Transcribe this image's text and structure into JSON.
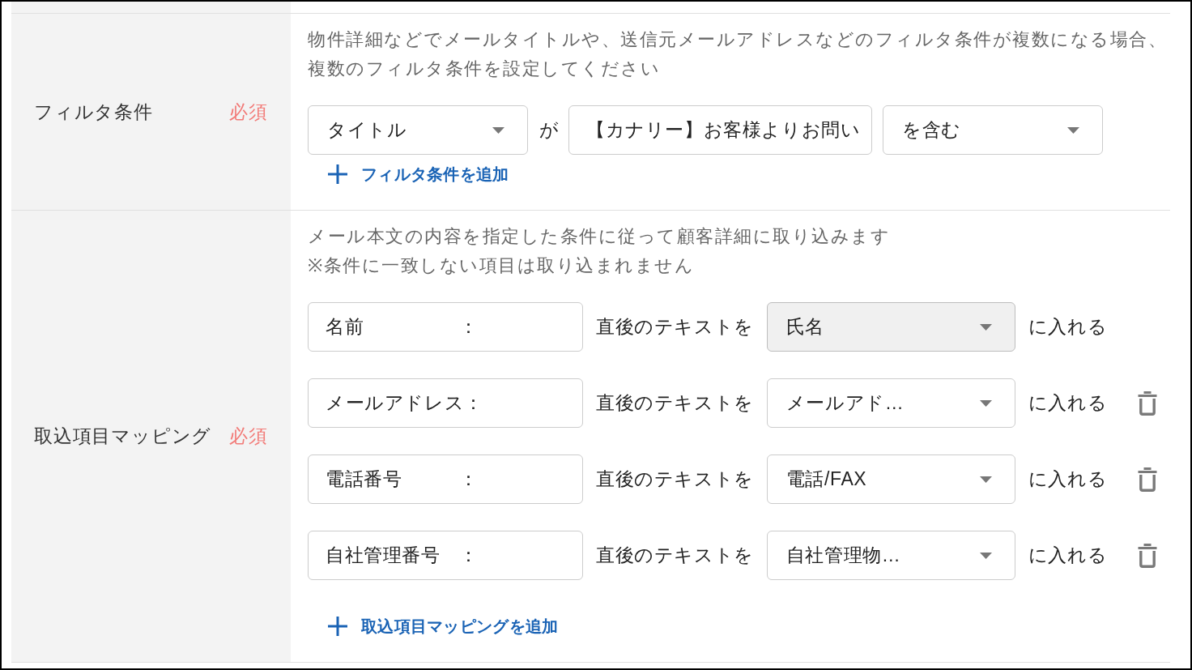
{
  "sections": [
    {
      "kind": "filter",
      "label": "フィルタ条件",
      "required_label": "必須",
      "description": [
        "物件詳細などでメールタイトルや、送信元メールアドレスなどのフィルタ条件が複数になる場合、",
        "複数のフィルタ条件を設定してください"
      ],
      "conditions": [
        {
          "field": "タイトル",
          "connector": "が",
          "value": "【カナリー】お客様よりお問い",
          "operator": "を含む"
        }
      ],
      "add_link": "フィルタ条件を追加"
    },
    {
      "kind": "mapping",
      "label": "取込項目マッピング",
      "required_label": "必須",
      "description": [
        "メール本文の内容を指定した条件に従って顧客詳細に取り込みます",
        "※条件に一致しない項目は取り込まれません"
      ],
      "mappings": [
        {
          "keyword": "名前　　　　　：",
          "middle_text": "直後のテキストを",
          "target": "氏名",
          "target_disabled": true,
          "suffix": "に入れる",
          "deletable": false
        },
        {
          "keyword": "メールアドレス：",
          "middle_text": "直後のテキストを",
          "target": "メールアド…",
          "target_disabled": false,
          "suffix": "に入れる",
          "deletable": true
        },
        {
          "keyword": "電話番号　　　：",
          "middle_text": "直後のテキストを",
          "target": "電話/FAX",
          "target_disabled": false,
          "suffix": "に入れる",
          "deletable": true
        },
        {
          "keyword": "自社管理番号　：",
          "middle_text": "直後のテキストを",
          "target": "自社管理物…",
          "target_disabled": false,
          "suffix": "に入れる",
          "deletable": true
        }
      ],
      "add_link": "取込項目マッピングを追加"
    }
  ]
}
